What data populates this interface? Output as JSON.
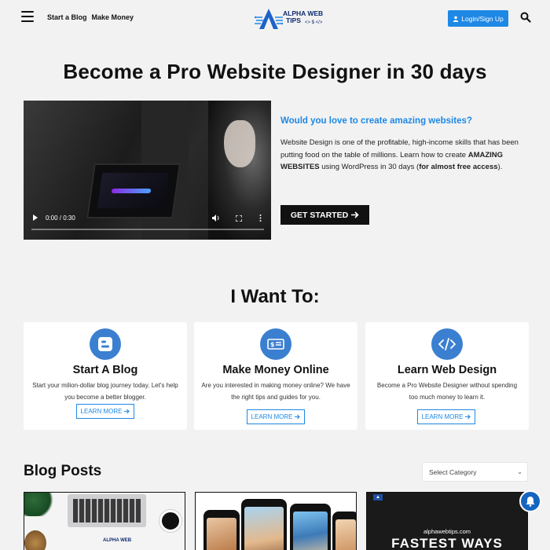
{
  "header": {
    "nav": [
      "Start a Blog",
      "Make Money"
    ],
    "logo_line1": "ALPHA WEB",
    "logo_line2": "TIPS",
    "logo_sub": "<> $ </>",
    "login_label": "Login/Sign Up"
  },
  "hero": {
    "title": "Become a Pro Website Designer in 30 days",
    "question": "Would you love to create amazing websites?",
    "p_part1": "Website Design is one of the profitable, high-income skills that has been putting food on the table of millions. Learn how to create ",
    "p_bold1": "AMAZING WEBSITES",
    "p_part2": " using WordPress in 30 days (",
    "p_bold2": "for almost free access",
    "p_part3": ").",
    "cta_label": "GET STARTED",
    "video_time": "0:00 / 0:30",
    "video_progress": 0
  },
  "want": {
    "title": "I Want To:",
    "cards": [
      {
        "title": "Start A Blog",
        "desc": "Start your milion-dollar blog journey today. Let's help you become a better blogger.",
        "link": "LEARN MORE"
      },
      {
        "title": "Make Money Online",
        "desc": "Are you interested in making money online? We have the right tips and guides for you.",
        "link": "LEARN MORE"
      },
      {
        "title": "Learn Web Design",
        "desc": "Become a Pro Website Designer without spending too much money to learn it.",
        "link": "LEARN MORE"
      }
    ]
  },
  "blog": {
    "title": "Blog Posts",
    "select_value": "Select Category",
    "post3_line1": "alphawebtips.com",
    "post3_line2": "FASTEST WAYS",
    "post1_logo": "ALPHA WEB"
  },
  "colors": {
    "accent": "#1e88e5",
    "icon_blue": "#3b7fd1",
    "dark": "#111111",
    "background": "#f2f2f2"
  }
}
